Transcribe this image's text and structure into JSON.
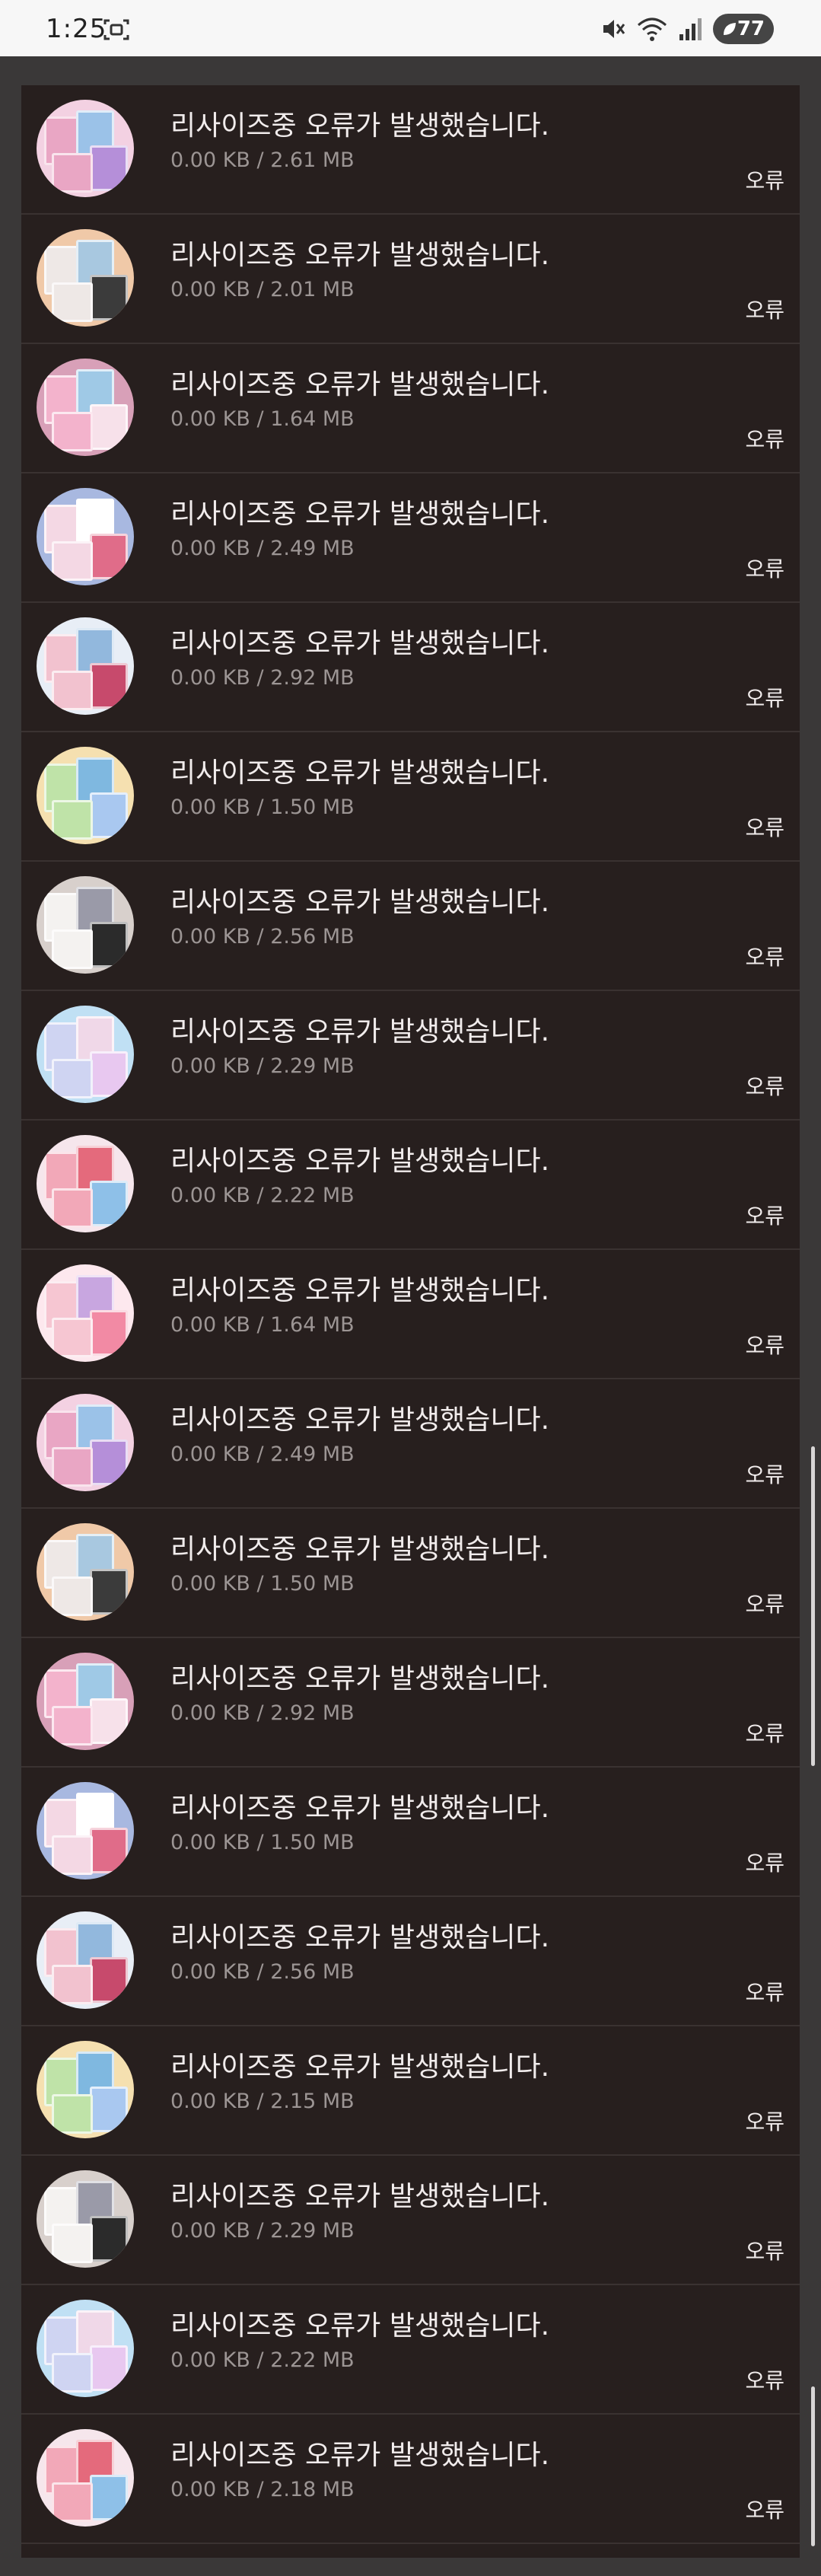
{
  "status_bar": {
    "time": "1:25",
    "battery": "77",
    "icons": [
      "screenshot-icon",
      "mute-icon",
      "wifi-icon",
      "signal-icon",
      "battery-icon"
    ]
  },
  "items": [
    {
      "title": "리사이즈중 오류가 발생했습니다.",
      "size": "0.00 KB / 2.61 MB",
      "status": "오류"
    },
    {
      "title": "리사이즈중 오류가 발생했습니다.",
      "size": "0.00 KB / 2.01 MB",
      "status": "오류"
    },
    {
      "title": "리사이즈중 오류가 발생했습니다.",
      "size": "0.00 KB / 1.64 MB",
      "status": "오류"
    },
    {
      "title": "리사이즈중 오류가 발생했습니다.",
      "size": "0.00 KB / 2.49 MB",
      "status": "오류"
    },
    {
      "title": "리사이즈중 오류가 발생했습니다.",
      "size": "0.00 KB / 2.92 MB",
      "status": "오류"
    },
    {
      "title": "리사이즈중 오류가 발생했습니다.",
      "size": "0.00 KB / 1.50 MB",
      "status": "오류"
    },
    {
      "title": "리사이즈중 오류가 발생했습니다.",
      "size": "0.00 KB / 2.56 MB",
      "status": "오류"
    },
    {
      "title": "리사이즈중 오류가 발생했습니다.",
      "size": "0.00 KB / 2.29 MB",
      "status": "오류"
    },
    {
      "title": "리사이즈중 오류가 발생했습니다.",
      "size": "0.00 KB / 2.22 MB",
      "status": "오류"
    },
    {
      "title": "리사이즈중 오류가 발생했습니다.",
      "size": "0.00 KB / 1.64 MB",
      "status": "오류"
    },
    {
      "title": "리사이즈중 오류가 발생했습니다.",
      "size": "0.00 KB / 2.49 MB",
      "status": "오류"
    },
    {
      "title": "리사이즈중 오류가 발생했습니다.",
      "size": "0.00 KB / 1.50 MB",
      "status": "오류"
    },
    {
      "title": "리사이즈중 오류가 발생했습니다.",
      "size": "0.00 KB / 2.92 MB",
      "status": "오류"
    },
    {
      "title": "리사이즈중 오류가 발생했습니다.",
      "size": "0.00 KB / 1.50 MB",
      "status": "오류"
    },
    {
      "title": "리사이즈중 오류가 발생했습니다.",
      "size": "0.00 KB / 2.56 MB",
      "status": "오류"
    },
    {
      "title": "리사이즈중 오류가 발생했습니다.",
      "size": "0.00 KB / 2.15 MB",
      "status": "오류"
    },
    {
      "title": "리사이즈중 오류가 발생했습니다.",
      "size": "0.00 KB / 2.29 MB",
      "status": "오류"
    },
    {
      "title": "리사이즈중 오류가 발생했습니다.",
      "size": "0.00 KB / 2.22 MB",
      "status": "오류"
    },
    {
      "title": "리사이즈중 오류가 발생했습니다.",
      "size": "0.00 KB / 2.18 MB",
      "status": "오류"
    }
  ],
  "colors": {
    "panel": "#271f1e",
    "text": "#f1ecec",
    "subtext": "#9c9594",
    "divider": "#3a3231"
  }
}
